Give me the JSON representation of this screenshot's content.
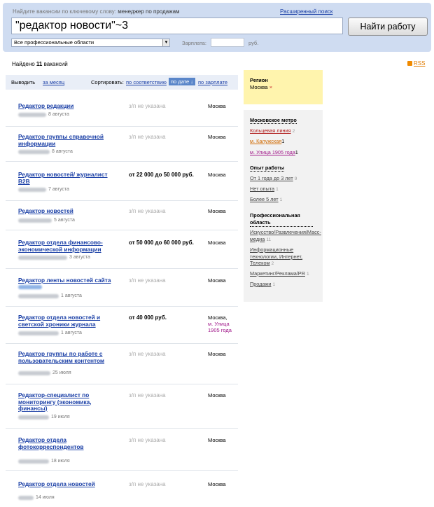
{
  "search": {
    "hint_prefix": "Найдите вакансии по ключевому слову:",
    "hint_example": "менеджер по продажам",
    "advanced_link": "Расширенный поиск",
    "query": "\"редактор новости\"~3",
    "button": "Найти работу",
    "area_select": "Все профессиональные области",
    "salary_label": "Зарплата:",
    "salary_value": "",
    "salary_unit": "руб."
  },
  "results": {
    "found_prefix": "Найдено",
    "found_count": "11",
    "found_suffix": "вакансий",
    "rss": "RSS"
  },
  "sortbar": {
    "period_label": "Выводить",
    "period_value": "за месяц",
    "sort_label": "Сортировать:",
    "by_relevance": "по соответствию",
    "by_date": "по дате ↓",
    "by_salary": "по зарплате"
  },
  "jobs": [
    {
      "title": "Редактор редакции",
      "date": "8 августа",
      "salary": "з/п не указана",
      "location": "Москва",
      "metro": ""
    },
    {
      "title": "Редактор группы справочной информации",
      "date": "8 августа",
      "salary": "з/п не указана",
      "location": "Москва",
      "metro": ""
    },
    {
      "title": "Редактор новостей/ журналист B2B",
      "date": "7 августа",
      "salary": "от 22 000 до 50 000 руб.",
      "location": "Москва",
      "metro": ""
    },
    {
      "title": "Редактор новостей",
      "date": "5 августа",
      "salary": "з/п не указана",
      "location": "Москва",
      "metro": ""
    },
    {
      "title": "Редактор отдела финансово-экономической информации",
      "date": "3 августа",
      "salary": "от 50 000 до 60 000 руб.",
      "location": "Москва",
      "metro": ""
    },
    {
      "title": "Редактор ленты новостей сайта",
      "date": "1 августа",
      "salary": "з/п не указана",
      "location": "Москва",
      "metro": ""
    },
    {
      "title": "Редактор отдела новостей и светской хроники журнала",
      "date": "1 августа",
      "salary": "от 40 000 руб.",
      "location": "Москва,",
      "metro": "м. Улица 1905 года"
    },
    {
      "title": "Редактор группы по работе с пользовательским контентом",
      "date": "25 июля",
      "salary": "з/п не указана",
      "location": "Москва",
      "metro": ""
    },
    {
      "title": "Редактор-специалист по мониторингу (экономика, финансы)",
      "date": "19 июля",
      "salary": "з/п не указана",
      "location": "Москва",
      "metro": ""
    },
    {
      "title": "Редактор отдела фотокорреспондентов",
      "date": "18 июля",
      "salary": "з/п не указана",
      "location": "Москва",
      "metro": ""
    },
    {
      "title": "Редактор отдела новостей",
      "date": "14 июля",
      "salary": "з/п не указана",
      "location": "Москва",
      "metro": ""
    }
  ],
  "region": {
    "heading": "Регион",
    "value": "Москва",
    "remove": "×"
  },
  "filters": {
    "metro_heading": "Московское метро",
    "metro": [
      {
        "label": "Кольцевая линия",
        "count": "2"
      },
      {
        "label": "м. Калужская",
        "count": "1"
      },
      {
        "label": "м. Улица 1905 года",
        "count": "1"
      }
    ],
    "exp_heading": "Опыт работы",
    "experience": [
      {
        "label": "От 1 года до 3 лет",
        "count": "9"
      },
      {
        "label": "Нет опыта",
        "count": "1"
      },
      {
        "label": "Более 5 лет",
        "count": "1"
      }
    ],
    "area_heading": "Профессиональная область",
    "areas": [
      {
        "label": "Искусство/Развлечения/Масс-медиа",
        "count": "11"
      },
      {
        "label": "Информационные технологии, Интернет, Телеком",
        "count": "2"
      },
      {
        "label": "Маркетинг/Реклама/PR",
        "count": "1"
      },
      {
        "label": "Продажи",
        "count": "1"
      }
    ]
  },
  "colors": {
    "header_bg": "#cfdcf1",
    "link": "#1a3fa6",
    "region_bg": "#fff4ad",
    "metro": "#a0198a"
  }
}
